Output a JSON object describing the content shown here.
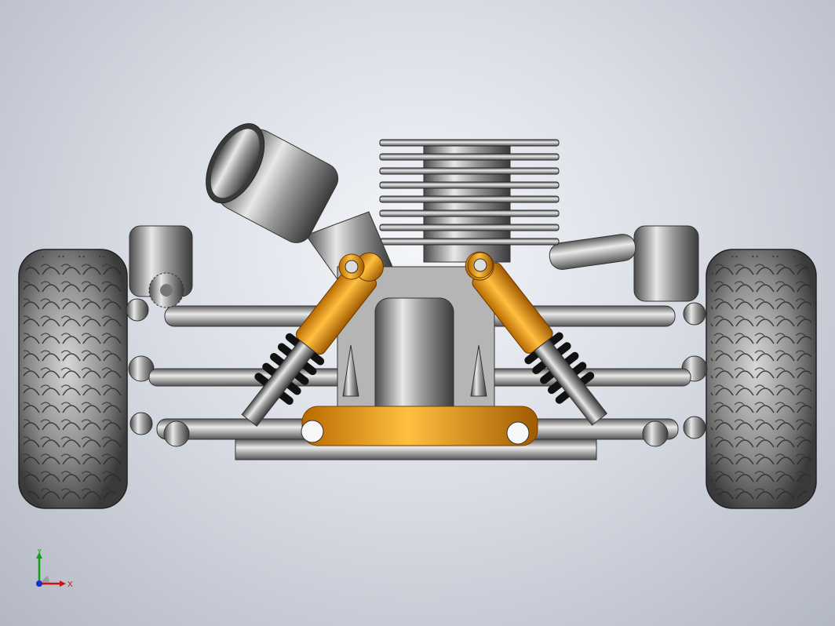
{
  "view": {
    "triad": {
      "x_label": "X",
      "y_label": "Y"
    },
    "colors": {
      "background_center": "#f4f6fa",
      "background_edge": "#b3b8c4",
      "metal": "#9a9a9a",
      "accent_orange": "#f0a020",
      "axis_x": "#d01010",
      "axis_y": "#10a010",
      "axis_z": "#1030d0"
    }
  }
}
